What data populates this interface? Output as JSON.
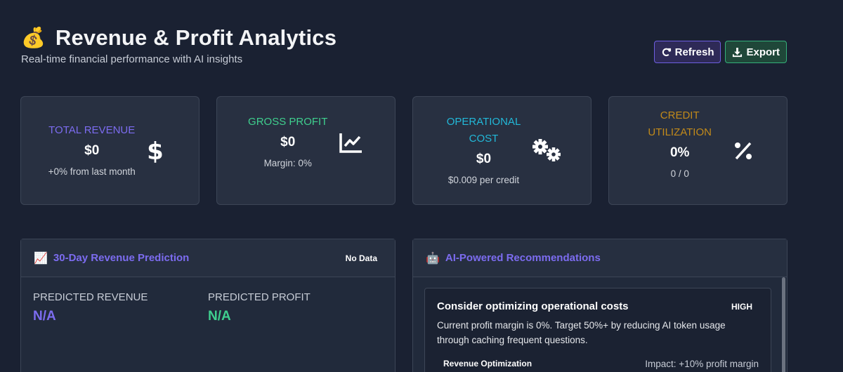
{
  "header": {
    "icon": "money-bag-icon",
    "emoji": "💰",
    "title": "Revenue & Profit Analytics",
    "subtitle": "Real-time financial performance with AI insights"
  },
  "actions": {
    "refresh_label": "Refresh",
    "export_label": "Export"
  },
  "stats": [
    {
      "label": "TOTAL REVENUE",
      "value": "$0",
      "sub": "+0% from last month",
      "color": "#7c6cf0",
      "icon": "dollar-icon"
    },
    {
      "label": "GROSS PROFIT",
      "value": "$0",
      "sub": "Margin: 0%",
      "color": "#3fcf8e",
      "icon": "chart-line-icon"
    },
    {
      "label": "OPERATIONAL COST",
      "value": "$0",
      "sub": "$0.009 per credit",
      "color": "#22b8d8",
      "icon": "gears-icon"
    },
    {
      "label": "CREDIT UTILIZATION",
      "value": "0%",
      "sub": "0 / 0",
      "color": "#c28a1a",
      "icon": "percent-icon"
    }
  ],
  "prediction": {
    "emoji": "📈",
    "title": "30-Day Revenue Prediction",
    "badge": "No Data",
    "revenue_label": "PREDICTED REVENUE",
    "revenue_value": "N/A",
    "revenue_color": "#7c6cf0",
    "profit_label": "PREDICTED PROFIT",
    "profit_value": "N/A",
    "profit_color": "#3fcf8e"
  },
  "recommendations": {
    "emoji": "🤖",
    "title": "AI-Powered Recommendations",
    "items": [
      {
        "title": "Consider optimizing operational costs",
        "priority": "HIGH",
        "description": "Current profit margin is 0%. Target 50%+ by reducing AI token usage through caching frequent questions.",
        "category": "Revenue Optimization",
        "impact": "Impact: +10% profit margin"
      }
    ]
  }
}
